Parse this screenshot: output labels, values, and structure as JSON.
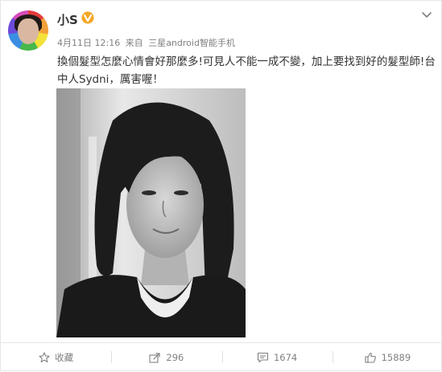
{
  "user": {
    "name": "小S",
    "verified_icon": "verified-v-badge-icon",
    "avatar_icon": "avatar-rainbow-portrait"
  },
  "meta": {
    "time": "4月11日 12:16",
    "from_label": "来自",
    "device": "三星android智能手机"
  },
  "post": {
    "text": "換個髮型怎麼心情會好那麼多!可見人不能一成不變，加上要找到好的髮型師!台中人Sydni，厲害喔！"
  },
  "actions": {
    "favorite": {
      "label": "收藏",
      "icon": "star-icon"
    },
    "repost": {
      "count": "296",
      "icon": "repost-icon"
    },
    "comment": {
      "count": "1674",
      "icon": "comment-icon"
    },
    "like": {
      "count": "15889",
      "icon": "thumbs-up-icon"
    }
  },
  "colors": {
    "text": "#333333",
    "meta": "#808080",
    "verified_badge": "#f5a623",
    "border": "#e6e6e6"
  }
}
